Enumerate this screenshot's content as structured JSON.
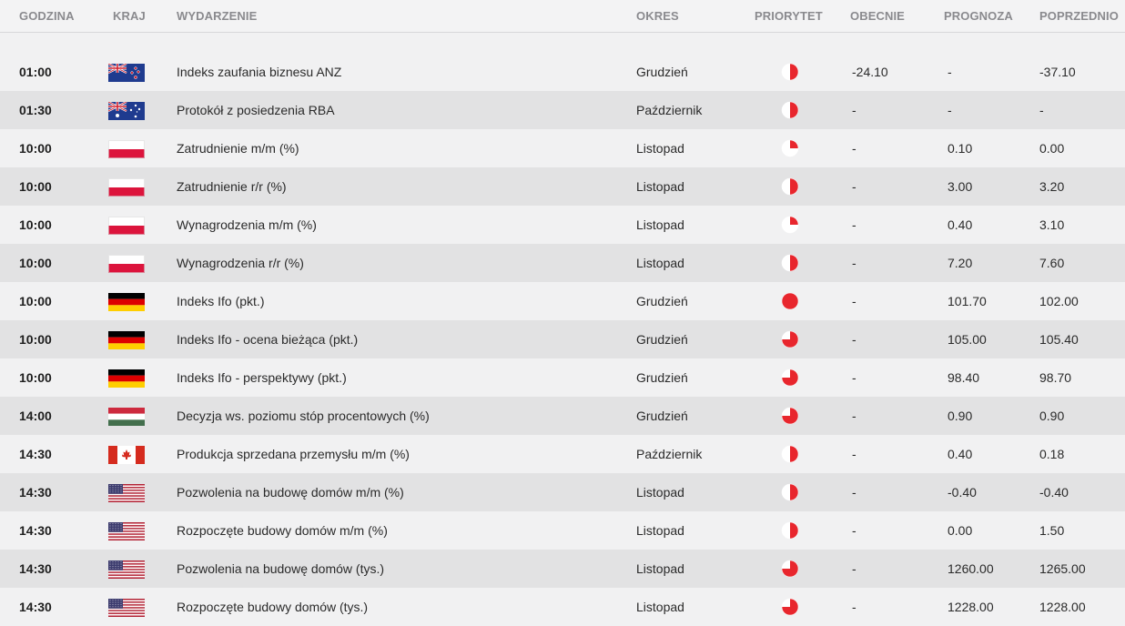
{
  "headers": {
    "time": "GODZINA",
    "country": "KRAJ",
    "event": "WYDARZENIE",
    "period": "OKRES",
    "priority": "PRIORYTET",
    "current": "OBECNIE",
    "forecast": "PROGNOZA",
    "previous": "POPRZEDNIO"
  },
  "colors": {
    "priority": "#e8262d",
    "row_even": "#e2e2e3",
    "row_odd": "#f1f1f2",
    "header_text": "#8a8a8e"
  },
  "rows": [
    {
      "time": "01:00",
      "flag": "nz-flag-icon",
      "event": "Indeks zaufania biznesu ANZ",
      "period": "Grudzień",
      "priority": 2,
      "current": "-24.10",
      "forecast": "-",
      "previous": "-37.10"
    },
    {
      "time": "01:30",
      "flag": "au-flag-icon",
      "event": "Protokół z posiedzenia RBA",
      "period": "Październik",
      "priority": 2,
      "current": "-",
      "forecast": "-",
      "previous": "-"
    },
    {
      "time": "10:00",
      "flag": "pl-flag-icon",
      "event": "Zatrudnienie m/m (%)",
      "period": "Listopad",
      "priority": 1,
      "current": "-",
      "forecast": "0.10",
      "previous": "0.00"
    },
    {
      "time": "10:00",
      "flag": "pl-flag-icon",
      "event": "Zatrudnienie r/r (%)",
      "period": "Listopad",
      "priority": 2,
      "current": "-",
      "forecast": "3.00",
      "previous": "3.20"
    },
    {
      "time": "10:00",
      "flag": "pl-flag-icon",
      "event": "Wynagrodzenia m/m (%)",
      "period": "Listopad",
      "priority": 1,
      "current": "-",
      "forecast": "0.40",
      "previous": "3.10"
    },
    {
      "time": "10:00",
      "flag": "pl-flag-icon",
      "event": "Wynagrodzenia r/r (%)",
      "period": "Listopad",
      "priority": 2,
      "current": "-",
      "forecast": "7.20",
      "previous": "7.60"
    },
    {
      "time": "10:00",
      "flag": "de-flag-icon",
      "event": "Indeks Ifo (pkt.)",
      "period": "Grudzień",
      "priority": 4,
      "current": "-",
      "forecast": "101.70",
      "previous": "102.00"
    },
    {
      "time": "10:00",
      "flag": "de-flag-icon",
      "event": "Indeks Ifo - ocena bieżąca (pkt.)",
      "period": "Grudzień",
      "priority": 3,
      "current": "-",
      "forecast": "105.00",
      "previous": "105.40"
    },
    {
      "time": "10:00",
      "flag": "de-flag-icon",
      "event": "Indeks Ifo - perspektywy (pkt.)",
      "period": "Grudzień",
      "priority": 3,
      "current": "-",
      "forecast": "98.40",
      "previous": "98.70"
    },
    {
      "time": "14:00",
      "flag": "hu-flag-icon",
      "event": "Decyzja ws. poziomu stóp procentowych (%)",
      "period": "Grudzień",
      "priority": 3,
      "current": "-",
      "forecast": "0.90",
      "previous": "0.90"
    },
    {
      "time": "14:30",
      "flag": "ca-flag-icon",
      "event": "Produkcja sprzedana przemysłu m/m (%)",
      "period": "Październik",
      "priority": 2,
      "current": "-",
      "forecast": "0.40",
      "previous": "0.18"
    },
    {
      "time": "14:30",
      "flag": "us-flag-icon",
      "event": "Pozwolenia na budowę domów m/m (%)",
      "period": "Listopad",
      "priority": 2,
      "current": "-",
      "forecast": "-0.40",
      "previous": "-0.40"
    },
    {
      "time": "14:30",
      "flag": "us-flag-icon",
      "event": "Rozpoczęte budowy domów m/m (%)",
      "period": "Listopad",
      "priority": 2,
      "current": "-",
      "forecast": "0.00",
      "previous": "1.50"
    },
    {
      "time": "14:30",
      "flag": "us-flag-icon",
      "event": "Pozwolenia na budowę domów (tys.)",
      "period": "Listopad",
      "priority": 3,
      "current": "-",
      "forecast": "1260.00",
      "previous": "1265.00"
    },
    {
      "time": "14:30",
      "flag": "us-flag-icon",
      "event": "Rozpoczęte budowy domów (tys.)",
      "period": "Listopad",
      "priority": 3,
      "current": "-",
      "forecast": "1228.00",
      "previous": "1228.00"
    }
  ]
}
